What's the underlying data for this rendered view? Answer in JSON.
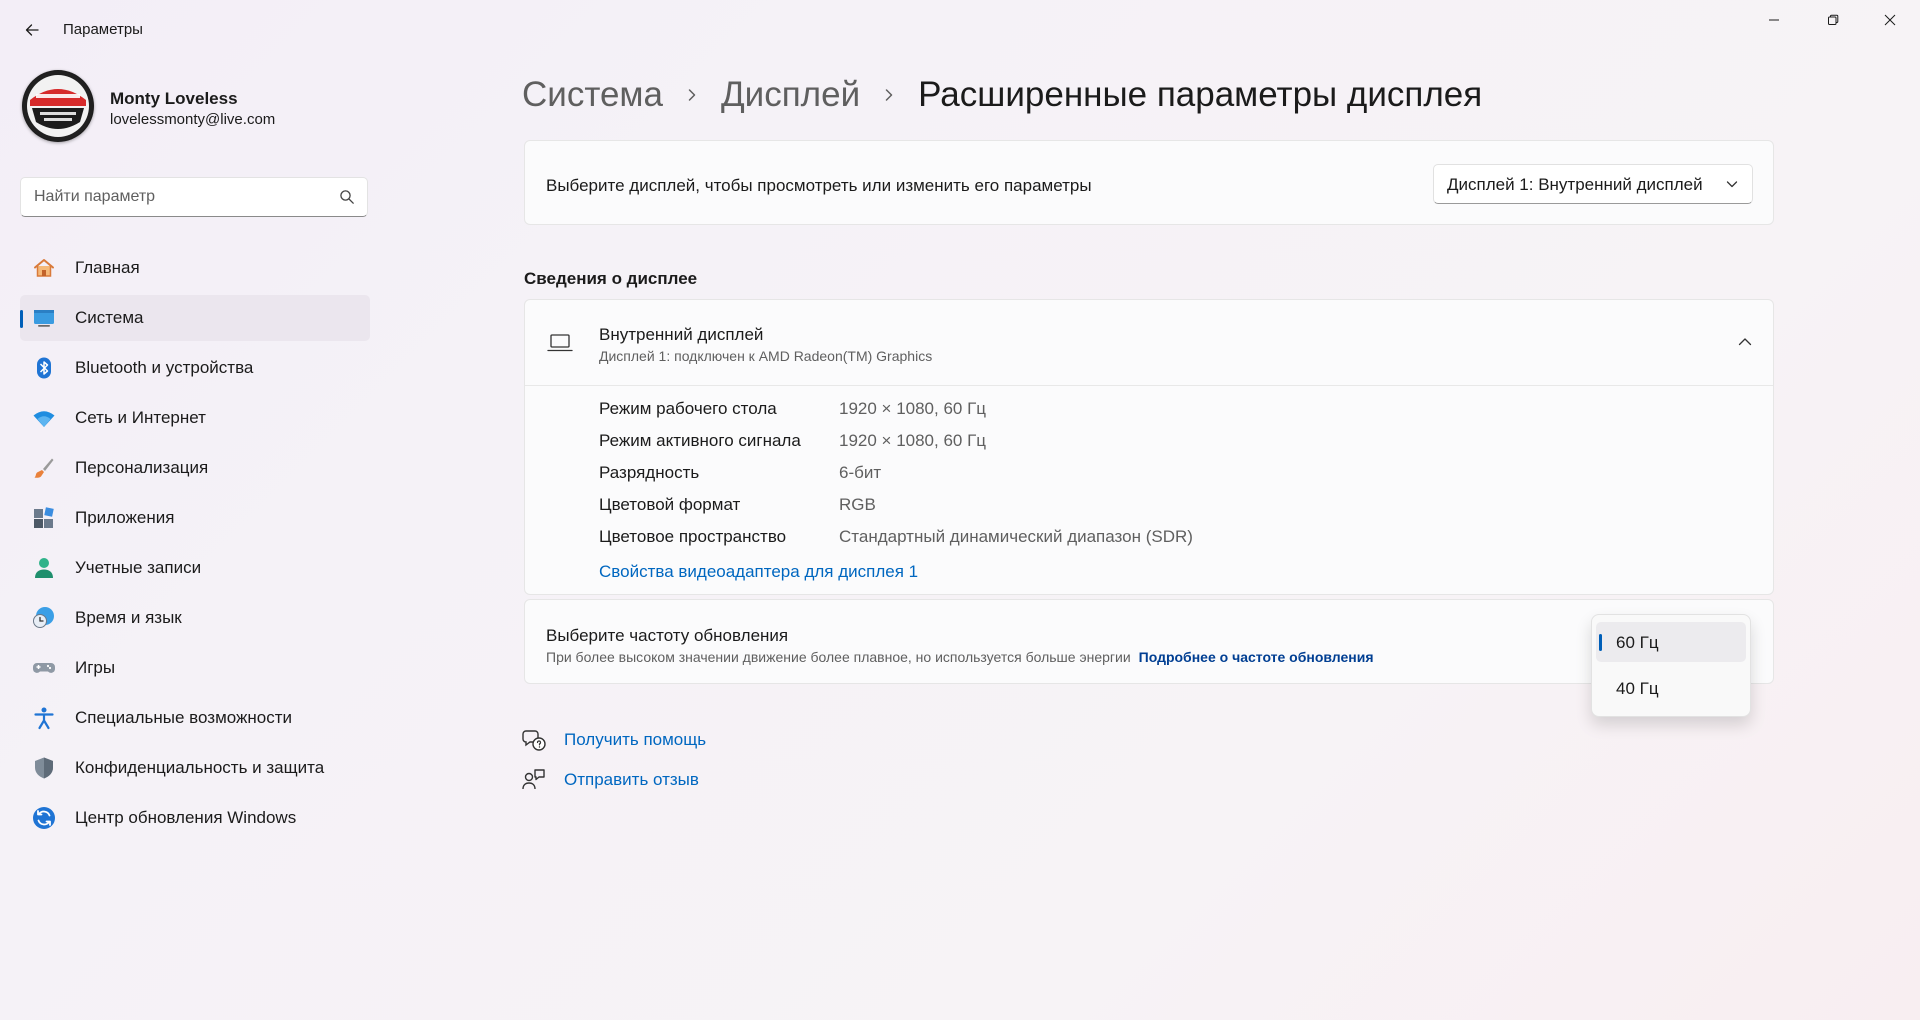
{
  "window": {
    "title": "Параметры"
  },
  "user": {
    "name": "Monty Loveless",
    "email": "lovelessmonty@live.com"
  },
  "search": {
    "placeholder": "Найти параметр"
  },
  "sidebar": {
    "items": [
      {
        "label": "Главная",
        "icon": "home-icon"
      },
      {
        "label": "Система",
        "icon": "system-icon",
        "active": true
      },
      {
        "label": "Bluetooth и устройства",
        "icon": "bluetooth-icon"
      },
      {
        "label": "Сеть и Интернет",
        "icon": "wifi-icon"
      },
      {
        "label": "Персонализация",
        "icon": "brush-icon"
      },
      {
        "label": "Приложения",
        "icon": "apps-icon"
      },
      {
        "label": "Учетные записи",
        "icon": "person-icon"
      },
      {
        "label": "Время и язык",
        "icon": "clock-globe-icon"
      },
      {
        "label": "Игры",
        "icon": "gamepad-icon"
      },
      {
        "label": "Специальные возможности",
        "icon": "accessibility-icon"
      },
      {
        "label": "Конфиденциальность и защита",
        "icon": "shield-icon"
      },
      {
        "label": "Центр обновления Windows",
        "icon": "update-icon"
      }
    ]
  },
  "breadcrumb": {
    "items": [
      "Система",
      "Дисплей"
    ],
    "current": "Расширенные параметры дисплея"
  },
  "display_select": {
    "label": "Выберите дисплей, чтобы просмотреть или изменить его параметры",
    "value": "Дисплей 1: Внутренний дисплей"
  },
  "display_info": {
    "section_title": "Сведения о дисплее",
    "title": "Внутренний дисплей",
    "subtitle": "Дисплей 1: подключен к AMD Radeon(TM) Graphics",
    "rows": [
      {
        "label": "Режим рабочего стола",
        "value": "1920 × 1080, 60 Гц"
      },
      {
        "label": "Режим активного сигнала",
        "value": "1920 × 1080, 60 Гц"
      },
      {
        "label": "Разрядность",
        "value": "6-бит"
      },
      {
        "label": "Цветовой формат",
        "value": "RGB"
      },
      {
        "label": "Цветовое пространство",
        "value": "Стандартный динамический диапазон (SDR)"
      }
    ],
    "adapter_link": "Свойства видеоадаптера для дисплея 1"
  },
  "refresh": {
    "title": "Выберите частоту обновления",
    "description": "При более высоком значении движение более плавное, но используется больше энергии",
    "link": "Подробнее о частоте обновления",
    "options": [
      "60 Гц",
      "40 Гц"
    ],
    "selected": "60 Гц"
  },
  "help": {
    "get_help": "Получить помощь",
    "feedback": "Отправить отзыв"
  },
  "colors": {
    "accent": "#005fb8",
    "link": "#0067c0",
    "link_dark": "#003e92"
  }
}
